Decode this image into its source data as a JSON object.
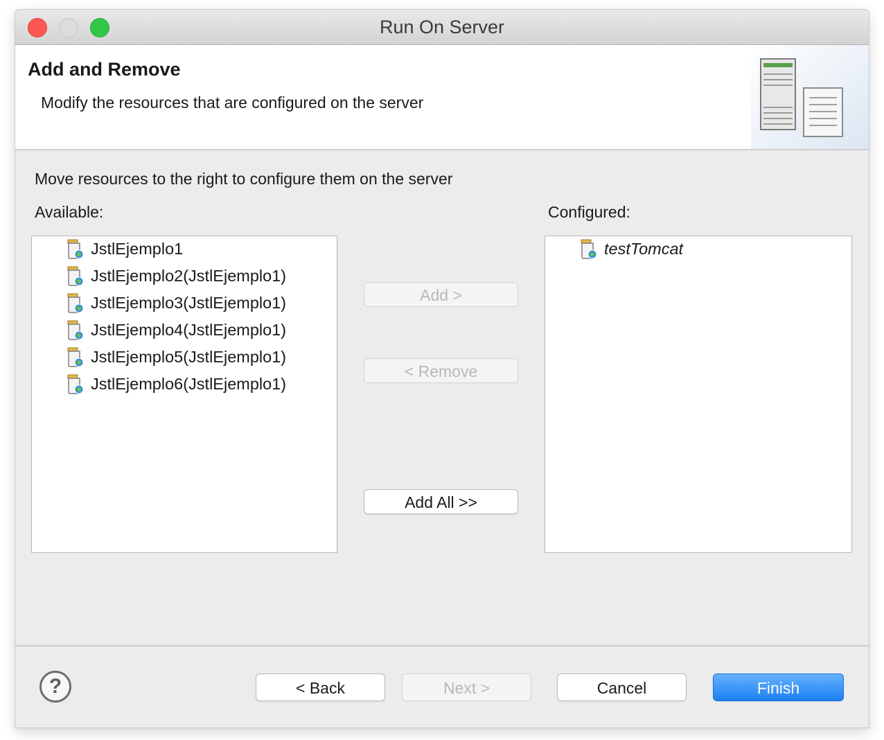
{
  "window": {
    "title": "Run On Server"
  },
  "header": {
    "title": "Add and Remove",
    "description": "Modify the resources that are configured on the server",
    "icon": "server-icon"
  },
  "main": {
    "instruction": "Move resources to the right to configure them on the server",
    "available_label": "Available:",
    "configured_label": "Configured:",
    "available_items": [
      "JstlEjemplo1",
      "JstlEjemplo2(JstlEjemplo1)",
      "JstlEjemplo3(JstlEjemplo1)",
      "JstlEjemplo4(JstlEjemplo1)",
      "JstlEjemplo5(JstlEjemplo1)",
      "JstlEjemplo6(JstlEjemplo1)"
    ],
    "configured_items": [
      "testTomcat"
    ],
    "add_label": "Add >",
    "remove_label": "< Remove",
    "add_all_label": "Add All >>"
  },
  "footer": {
    "help": "?",
    "back_label": "< Back",
    "next_label": "Next >",
    "cancel_label": "Cancel",
    "finish_label": "Finish"
  },
  "colors": {
    "finish_button": "#1c7ff3",
    "close_button": "#fc5753",
    "zoom_button": "#33c748"
  }
}
